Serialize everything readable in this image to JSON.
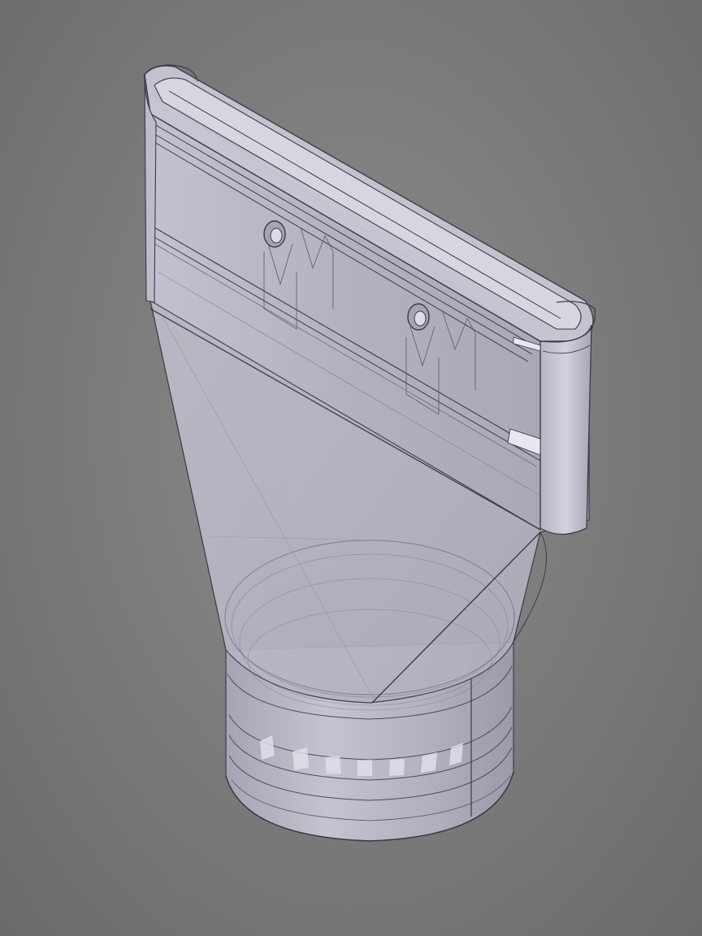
{
  "viewport": {
    "background_color": "#7f7f7f",
    "model_fill_color": "#b9b8c6",
    "edge_color": "#3a3a48",
    "render_mode": "transparent-shaded-with-edges"
  },
  "model": {
    "description_icon": "nozzle-adapter-3d-model"
  }
}
